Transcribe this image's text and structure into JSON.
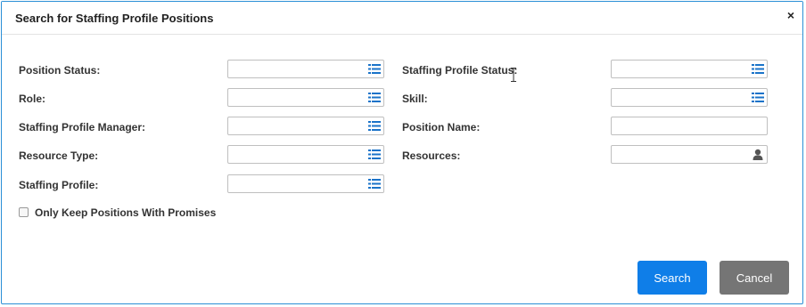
{
  "dialog": {
    "title": "Search for Staffing Profile Positions",
    "close_symbol": "×"
  },
  "fields": {
    "position_status": {
      "label": "Position Status:",
      "value": "",
      "icon": "list-icon"
    },
    "role": {
      "label": "Role:",
      "value": "",
      "icon": "list-icon"
    },
    "staffing_profile_manager": {
      "label": "Staffing Profile Manager:",
      "value": "",
      "icon": "list-icon"
    },
    "resource_type": {
      "label": "Resource Type:",
      "value": "",
      "icon": "list-icon"
    },
    "staffing_profile": {
      "label": "Staffing Profile:",
      "value": "",
      "icon": "list-icon"
    },
    "staffing_profile_status": {
      "label": "Staffing Profile Status:",
      "value": "",
      "icon": "list-icon"
    },
    "skill": {
      "label": "Skill:",
      "value": "",
      "icon": "list-icon"
    },
    "position_name": {
      "label": "Position Name:",
      "value": ""
    },
    "resources": {
      "label": "Resources:",
      "value": "",
      "icon": "person-icon"
    }
  },
  "options": {
    "only_keep_promises": {
      "label": "Only Keep Positions With Promises",
      "checked": false
    }
  },
  "buttons": {
    "search": "Search",
    "cancel": "Cancel"
  },
  "colors": {
    "accent": "#0f7ee8",
    "cancel": "#757575",
    "border": "#2a8fd6",
    "icon": "#1a73c9"
  }
}
